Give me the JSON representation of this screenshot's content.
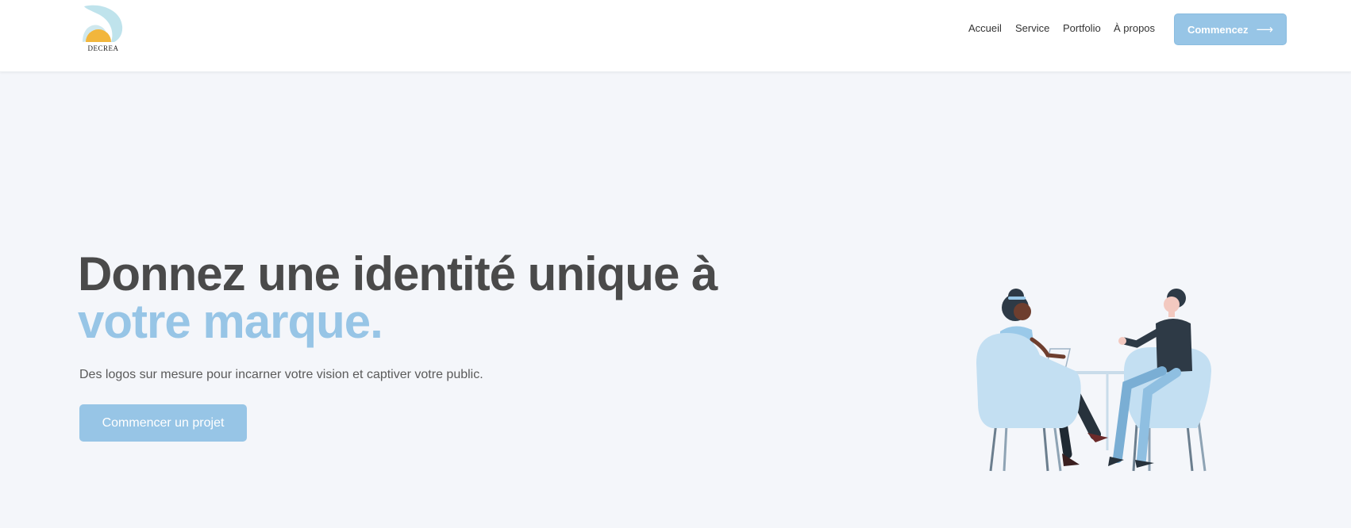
{
  "header": {
    "logo_text": "DECREA",
    "nav": [
      {
        "label": "Accueil"
      },
      {
        "label": "Service"
      },
      {
        "label": "Portfolio"
      },
      {
        "label": "À propos"
      }
    ],
    "cta_label": "Commencez",
    "cta_icon": "arrow-right-icon"
  },
  "hero": {
    "title_line1": "Donnez une identité unique à",
    "title_line2": "votre marque.",
    "subtitle": "Des logos sur mesure pour incarner votre vision et captiver votre public.",
    "cta_label": "Commencer un projet",
    "illustration": "meeting-illustration"
  },
  "colors": {
    "accent": "#97c5e6",
    "heading": "#4a4a4a",
    "background": "#f4f6fa",
    "header_bg": "#ffffff",
    "logo_sun": "#f2b63c",
    "logo_wave": "#bfe3ec"
  }
}
